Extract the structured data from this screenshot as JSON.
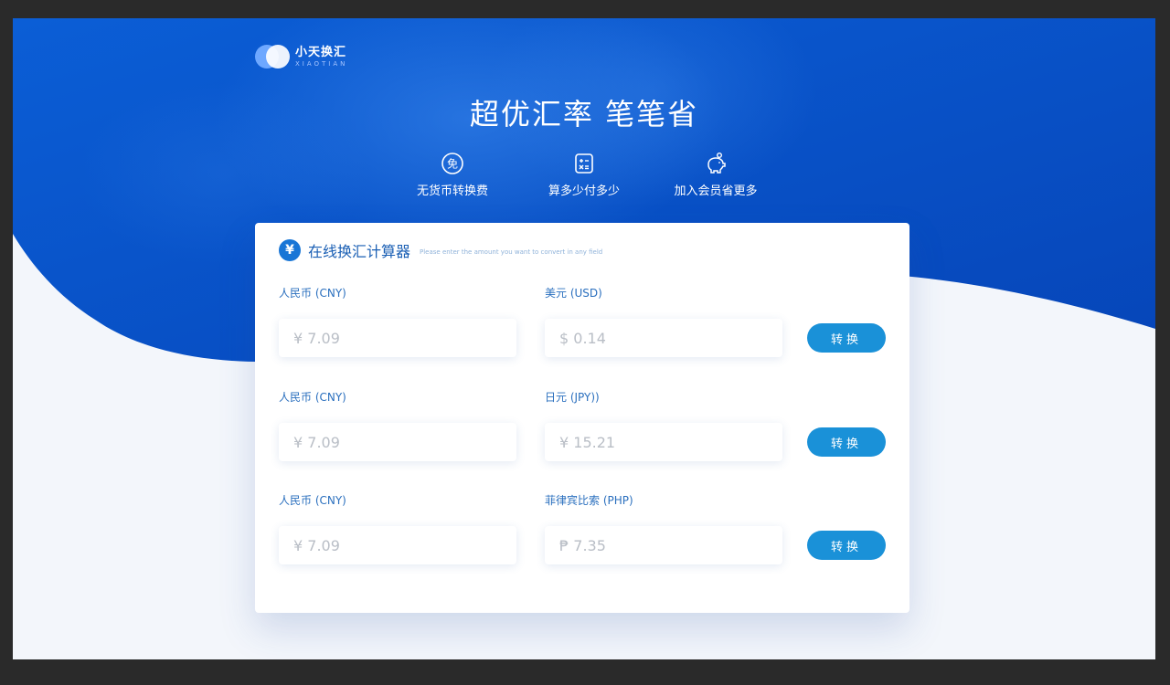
{
  "brand": {
    "name_cn": "小天换汇",
    "name_en": "XIAOTIAN"
  },
  "hero": {
    "title": "超优汇率 笔笔省"
  },
  "features": [
    {
      "icon": "free-badge-icon",
      "label": "无货币转换费"
    },
    {
      "icon": "calculator-icon",
      "label": "算多少付多少"
    },
    {
      "icon": "piggy-bank-icon",
      "label": "加入会员省更多"
    }
  ],
  "calculator": {
    "icon": "yen-icon",
    "icon_glyph": "¥",
    "title": "在线换汇计算器",
    "subtitle": "Please enter the amount you want to convert in any field",
    "rows": [
      {
        "from_label": "人民币 (CNY)",
        "from_value": "¥ 7.09",
        "to_label": "美元 (USD)",
        "to_value": "$ 0.14",
        "button": "转换"
      },
      {
        "from_label": "人民币 (CNY)",
        "from_value": "¥ 7.09",
        "to_label": "日元 (JPY))",
        "to_value": "¥ 15.21",
        "button": "转换"
      },
      {
        "from_label": "人民币 (CNY)",
        "from_value": "¥ 7.09",
        "to_label": "菲律宾比索 (PHP)",
        "to_value": "₱ 7.35",
        "button": "转换"
      }
    ]
  },
  "colors": {
    "hero_blue": "#0a56c9",
    "accent": "#1a91d8",
    "label": "#2a6fbe"
  }
}
